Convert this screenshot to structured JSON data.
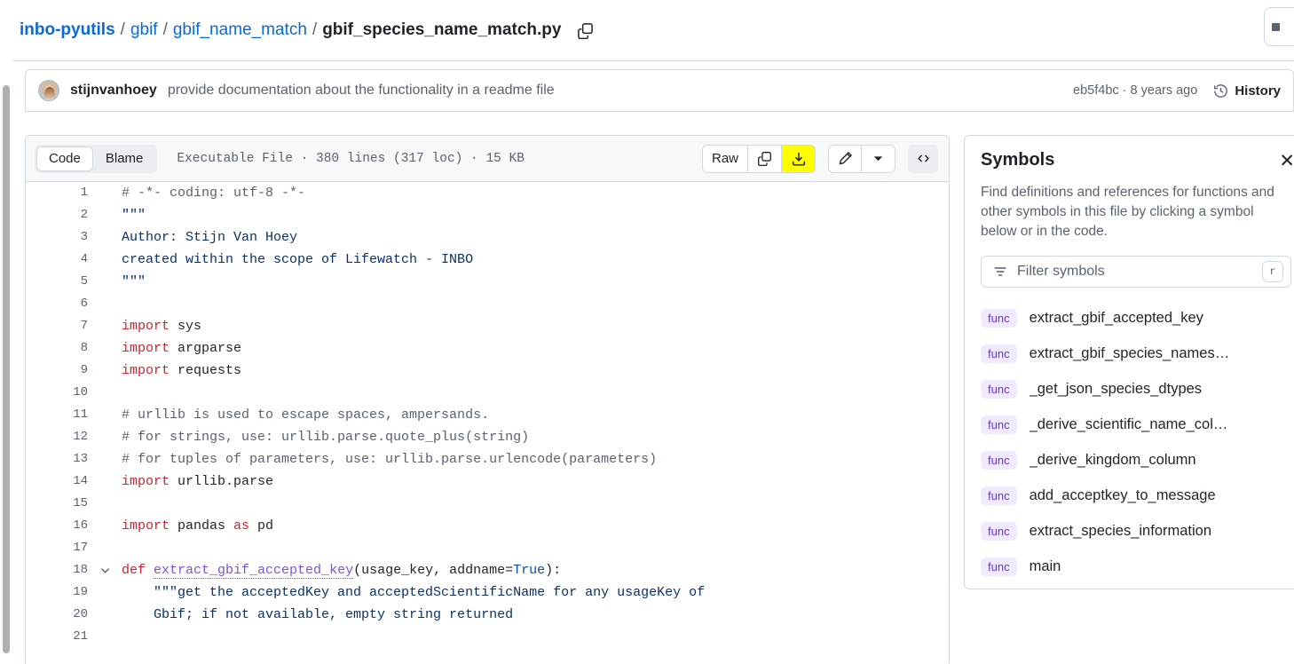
{
  "breadcrumb": {
    "repo": "inbo-pyutils",
    "sep": "/",
    "dir1": "gbif",
    "dir2": "gbif_name_match",
    "file": "gbif_species_name_match.py",
    "copy_path_icon": "copy-icon"
  },
  "commit": {
    "author": "stijnvanhoey",
    "message": "provide documentation about the functionality in a readme file",
    "sha": "eb5f4bc",
    "sha_separator": " · ",
    "relative_time": "8 years ago",
    "history_label": "History",
    "history_icon": "history-icon"
  },
  "toolbar": {
    "tabs": [
      {
        "label": "Code",
        "active": true
      },
      {
        "label": "Blame",
        "active": false
      }
    ],
    "file_meta": "Executable File  ·  380 lines (317 loc)  ·  15 KB",
    "raw_label": "Raw",
    "copy_icon": "copy-icon",
    "download_icon": "download-icon",
    "edit_icon": "pencil-icon",
    "dropdown_icon": "chevron-down-icon",
    "symbols_toggle_icon": "code-brackets-icon",
    "download_highlight_color": "#ffff00"
  },
  "code": {
    "language": "python",
    "lines": [
      {
        "n": 1,
        "fold": false,
        "tokens": [
          {
            "t": "# -*- coding: utf-8 -*-",
            "c": "tok-com"
          }
        ]
      },
      {
        "n": 2,
        "fold": false,
        "tokens": [
          {
            "t": "\"\"\"",
            "c": "tok-str"
          }
        ]
      },
      {
        "n": 3,
        "fold": false,
        "tokens": [
          {
            "t": "Author: Stijn Van Hoey",
            "c": "tok-str"
          }
        ]
      },
      {
        "n": 4,
        "fold": false,
        "tokens": [
          {
            "t": "created within the scope of Lifewatch - INBO",
            "c": "tok-str"
          }
        ]
      },
      {
        "n": 5,
        "fold": false,
        "tokens": [
          {
            "t": "\"\"\"",
            "c": "tok-str"
          }
        ]
      },
      {
        "n": 6,
        "fold": false,
        "tokens": []
      },
      {
        "n": 7,
        "fold": false,
        "tokens": [
          {
            "t": "import",
            "c": "tok-kw"
          },
          {
            "t": " sys",
            "c": "tok-plain"
          }
        ]
      },
      {
        "n": 8,
        "fold": false,
        "tokens": [
          {
            "t": "import",
            "c": "tok-kw"
          },
          {
            "t": " argparse",
            "c": "tok-plain"
          }
        ]
      },
      {
        "n": 9,
        "fold": false,
        "tokens": [
          {
            "t": "import",
            "c": "tok-kw"
          },
          {
            "t": " requests",
            "c": "tok-plain"
          }
        ]
      },
      {
        "n": 10,
        "fold": false,
        "tokens": []
      },
      {
        "n": 11,
        "fold": false,
        "tokens": [
          {
            "t": "# urllib is used to escape spaces, ampersands.",
            "c": "tok-com"
          }
        ]
      },
      {
        "n": 12,
        "fold": false,
        "tokens": [
          {
            "t": "# for strings, use: urllib.parse.quote_plus(string)",
            "c": "tok-com"
          }
        ]
      },
      {
        "n": 13,
        "fold": false,
        "tokens": [
          {
            "t": "# for tuples of parameters, use: urllib.parse.urlencode(parameters)",
            "c": "tok-com"
          }
        ]
      },
      {
        "n": 14,
        "fold": false,
        "tokens": [
          {
            "t": "import",
            "c": "tok-kw"
          },
          {
            "t": " urllib.parse",
            "c": "tok-plain"
          }
        ]
      },
      {
        "n": 15,
        "fold": false,
        "tokens": []
      },
      {
        "n": 16,
        "fold": false,
        "tokens": [
          {
            "t": "import",
            "c": "tok-kw"
          },
          {
            "t": " pandas ",
            "c": "tok-plain"
          },
          {
            "t": "as",
            "c": "tok-kw"
          },
          {
            "t": " pd",
            "c": "tok-plain"
          }
        ]
      },
      {
        "n": 17,
        "fold": false,
        "tokens": []
      },
      {
        "n": 18,
        "fold": true,
        "tokens": [
          {
            "t": "def",
            "c": "tok-kw"
          },
          {
            "t": " ",
            "c": "tok-plain"
          },
          {
            "t": "extract_gbif_accepted_key",
            "c": "tok-fn"
          },
          {
            "t": "(usage_key, addname=",
            "c": "tok-plain"
          },
          {
            "t": "True",
            "c": "tok-const"
          },
          {
            "t": "):",
            "c": "tok-plain"
          }
        ]
      },
      {
        "n": 19,
        "fold": false,
        "tokens": [
          {
            "t": "    \"\"\"get the acceptedKey and acceptedScientificName for any usageKey of",
            "c": "tok-str"
          }
        ]
      },
      {
        "n": 20,
        "fold": false,
        "tokens": [
          {
            "t": "    Gbif; if not available, empty string returned",
            "c": "tok-str"
          }
        ]
      },
      {
        "n": 21,
        "fold": false,
        "tokens": []
      }
    ]
  },
  "symbols": {
    "title": "Symbols",
    "close_icon": "close-icon",
    "description": "Find definitions and references for functions and other symbols in this file by clicking a symbol below or in the code.",
    "filter_icon": "filter-icon",
    "filter_placeholder": "Filter symbols",
    "filter_value": "",
    "filter_shortcut": "r",
    "items": [
      {
        "kind": "func",
        "name": "extract_gbif_accepted_key"
      },
      {
        "kind": "func",
        "name": "extract_gbif_species_names…"
      },
      {
        "kind": "func",
        "name": "_get_json_species_dtypes"
      },
      {
        "kind": "func",
        "name": "_derive_scientific_name_col…"
      },
      {
        "kind": "func",
        "name": "_derive_kingdom_column"
      },
      {
        "kind": "func",
        "name": "add_acceptkey_to_message"
      },
      {
        "kind": "func",
        "name": "extract_species_information"
      },
      {
        "kind": "func",
        "name": "main"
      }
    ]
  },
  "colors": {
    "link": "#0969da",
    "text": "#1f2328",
    "muted": "#59636e",
    "border": "#d1d9e0",
    "canvas_subtle": "#f6f8fa",
    "keyword": "#cf222e",
    "string": "#0a3069",
    "entity": "#8250df",
    "constant": "#0550ae",
    "symbol_badge_bg": "#f0eaff",
    "symbol_badge_fg": "#6639ba"
  }
}
